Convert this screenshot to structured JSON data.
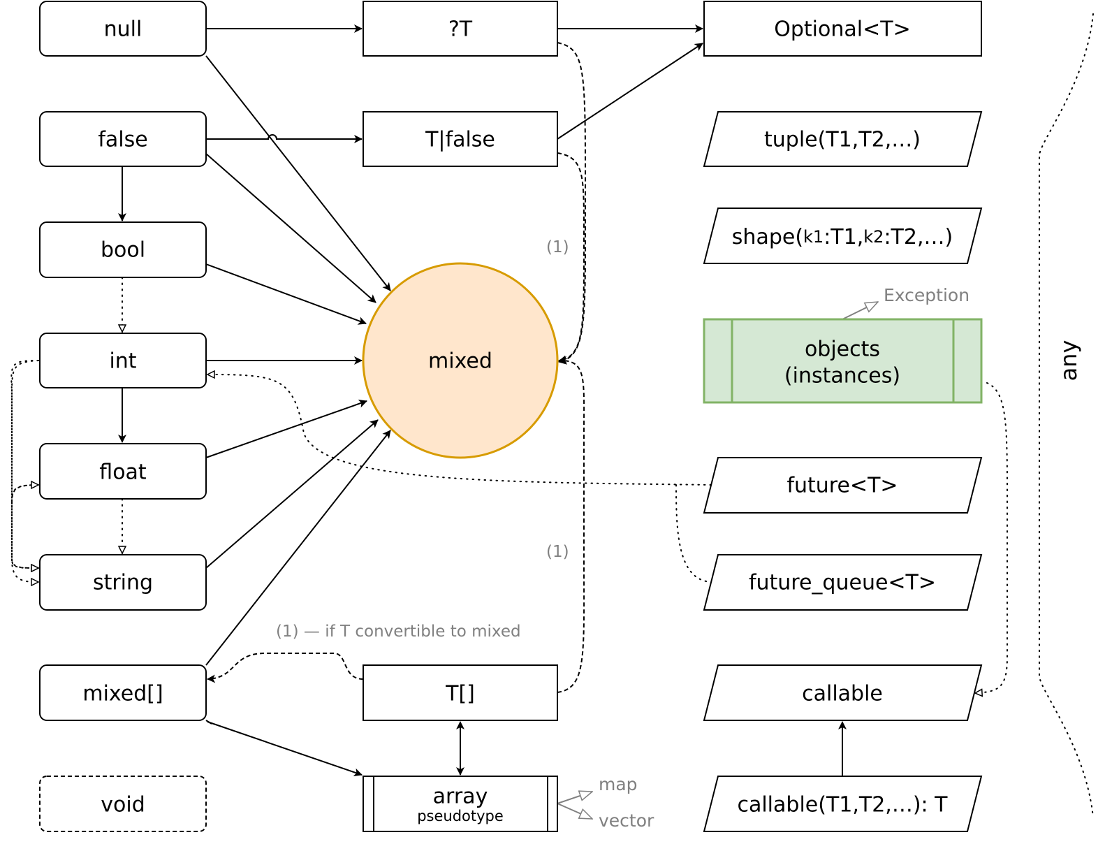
{
  "left": {
    "null": "null",
    "false": "false",
    "bool": "bool",
    "int": "int",
    "float": "float",
    "string": "string",
    "mixed_array": "mixed[]",
    "void": "void"
  },
  "middle": {
    "nullable": "?T",
    "t_or_false": "T|false",
    "mixed": "mixed",
    "t_array": "T[]",
    "array": "array",
    "array_sub": "pseudotype"
  },
  "right": {
    "optional": "Optional<T>",
    "tuple": "tuple(T1,T2,…)",
    "shape": [
      "shape(",
      "k1",
      ":T1,",
      "k2",
      ":T2,…)"
    ],
    "objects_line1": "objects",
    "objects_line2": "(instances)",
    "future": "future<T>",
    "future_queue": "future_queue<T>",
    "callable": "callable",
    "callable_sig": "callable(T1,T2,…): T"
  },
  "notes": {
    "one_a": "(1)",
    "one_b": "(1)",
    "one_cond": "(1) — if T convertible to mixed",
    "exception": "Exception",
    "map": "map",
    "vector": "vector",
    "any": "any"
  },
  "colors": {
    "mixed_fill": "#ffe6cc",
    "mixed_stroke": "#d79b00",
    "objects_fill": "#d5e8d4",
    "objects_stroke": "#82b366",
    "note": "#808080"
  }
}
